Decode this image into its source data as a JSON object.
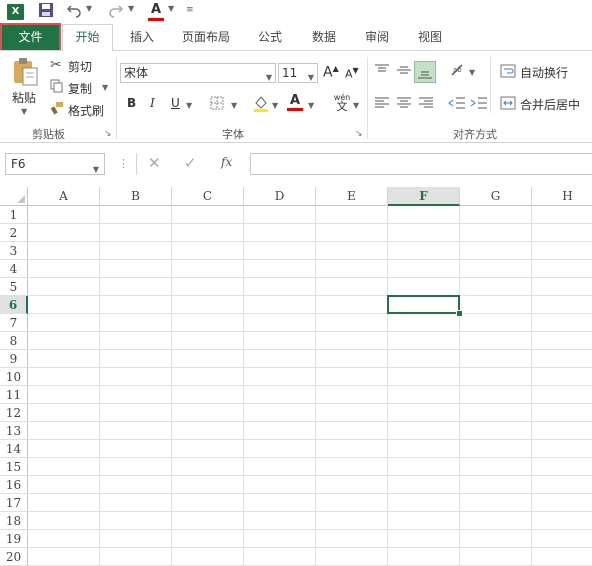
{
  "quick_access": {
    "app_icon": "X",
    "icons": [
      "excel-logo-icon",
      "save-icon",
      "undo-icon",
      "redo-icon",
      "font-color-icon",
      "customize-icon"
    ]
  },
  "tabs": [
    {
      "label": "文件"
    },
    {
      "label": "开始"
    },
    {
      "label": "插入"
    },
    {
      "label": "页面布局"
    },
    {
      "label": "公式"
    },
    {
      "label": "数据"
    },
    {
      "label": "审阅"
    },
    {
      "label": "视图"
    }
  ],
  "ribbon": {
    "clipboard": {
      "paste_label": "粘贴",
      "cut_label": "剪切",
      "copy_label": "复制",
      "format_painter_label": "格式刷",
      "group_label": "剪贴板"
    },
    "font": {
      "font_name": "宋体",
      "font_size": "11",
      "bold": "B",
      "italic": "I",
      "underline": "U",
      "increase": "A",
      "decrease": "A",
      "font_color": "A",
      "phonetic": "wén",
      "group_label": "字体"
    },
    "alignment": {
      "wrap_label": "自动换行",
      "merge_label": "合并后居中",
      "group_label": "对齐方式"
    }
  },
  "formula_bar": {
    "name_box": "F6",
    "fx": "fx",
    "value": ""
  },
  "grid": {
    "columns": [
      "A",
      "B",
      "C",
      "D",
      "E",
      "F",
      "G",
      "H"
    ],
    "rows": [
      "1",
      "2",
      "3",
      "4",
      "5",
      "6",
      "7",
      "8",
      "9",
      "10",
      "11",
      "12",
      "13",
      "14",
      "15",
      "16",
      "17",
      "18",
      "19",
      "20"
    ],
    "selected_column": "F",
    "selected_row": "6",
    "active_cell": "F6"
  },
  "colors": {
    "accent": "#217346",
    "file_tab": "#217346",
    "highlight_border": "#d9534f"
  }
}
